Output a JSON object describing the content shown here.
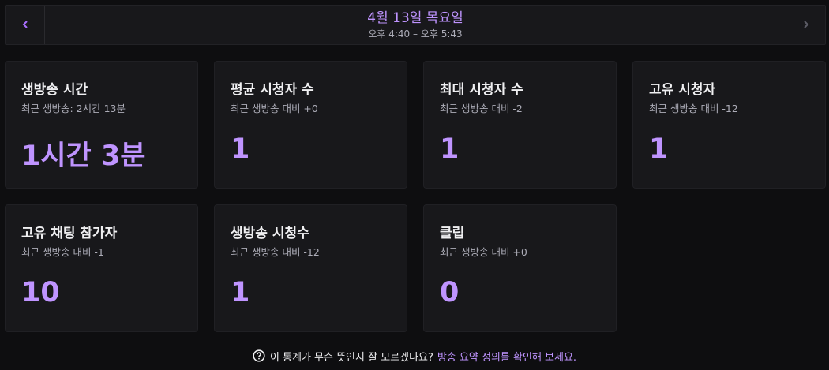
{
  "header": {
    "date": "4월 13일 목요일",
    "time_range": "오후 4:40 – 오후 5:43",
    "prev_icon": "chevron-left-icon",
    "next_icon": "chevron-right-icon"
  },
  "stats": [
    {
      "title": "생방송 시간",
      "subtitle": "최근 생방송: 2시간 13분",
      "value": "1시간 3분"
    },
    {
      "title": "평균 시청자 수",
      "subtitle": "최근 생방송 대비 +0",
      "value": "1"
    },
    {
      "title": "최대 시청자 수",
      "subtitle": "최근 생방송 대비 -2",
      "value": "1"
    },
    {
      "title": "고유 시청자",
      "subtitle": "최근 생방송 대비 -12",
      "value": "1"
    },
    {
      "title": "고유 채팅 참가자",
      "subtitle": "최근 생방송 대비 -1",
      "value": "10"
    },
    {
      "title": "생방송 시청수",
      "subtitle": "최근 생방송 대비 -12",
      "value": "1"
    },
    {
      "title": "클립",
      "subtitle": "최근 생방송 대비 +0",
      "value": "0"
    }
  ],
  "footer": {
    "help_icon": "question-circle-icon",
    "text": "이 통계가 무슨 뜻인지 잘 모르겠나요?",
    "link": "방송 요약 정의를 확인해 보세요."
  },
  "colors": {
    "accent": "#bf94ff",
    "background": "#0e0e10",
    "card": "#18181b"
  }
}
